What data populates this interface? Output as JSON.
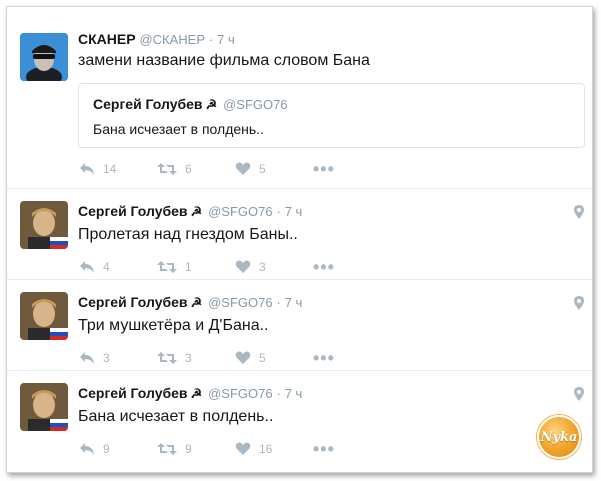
{
  "tweets": [
    {
      "name": "СКАНЕР",
      "handle": "@СКАНЕР",
      "time": "7 ч",
      "text": "замени название фильма словом Бана",
      "quote": {
        "name": "Сергей Голубев",
        "handle": "@SFGO76",
        "text": "Бана исчезает в полдень.."
      },
      "replies": "14",
      "retweets": "6",
      "likes": "5"
    },
    {
      "name": "Сергей Голубев",
      "handle": "@SFGO76",
      "time": "7 ч",
      "text": "Пролетая над гнездом Баны..",
      "replies": "4",
      "retweets": "1",
      "likes": "3"
    },
    {
      "name": "Сергей Голубев",
      "handle": "@SFGO76",
      "time": "7 ч",
      "text": "Три мушкетёра и Д'Бана..",
      "replies": "3",
      "retweets": "3",
      "likes": "5"
    },
    {
      "name": "Сергей Голубев",
      "handle": "@SFGO76",
      "time": "7 ч",
      "text": "Бана исчезает в полдень..",
      "replies": "9",
      "retweets": "9",
      "likes": "16"
    }
  ],
  "watermark": {
    "text": "Nyka"
  },
  "colors": {
    "text": "#14171a",
    "muted": "#8899a6",
    "action": "#aab8c2",
    "border": "#e6ecf0"
  }
}
